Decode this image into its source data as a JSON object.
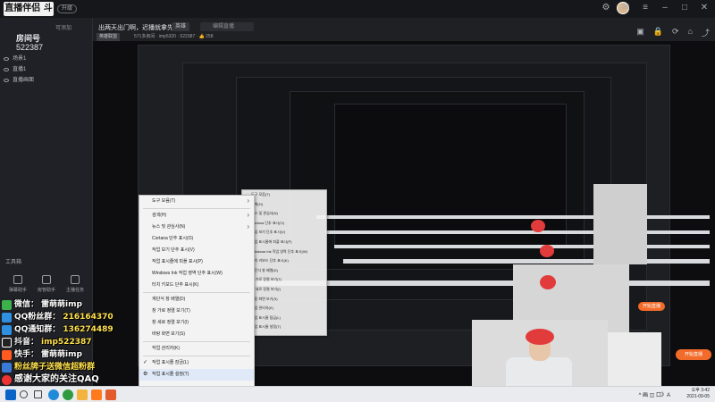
{
  "titlebar": {
    "logo_text": "直播伴侣 斗鱼",
    "version_badge": "升级",
    "window_controls": [
      "minimize",
      "maximize",
      "close"
    ]
  },
  "left_panel": {
    "room_label": "房间号",
    "room_number": "522387",
    "scene_label": "可添加",
    "scenes": [
      {
        "label": "场景1",
        "icon": "eye-icon"
      },
      {
        "label": "直播1",
        "icon": "eye-icon"
      },
      {
        "label": "直播画面",
        "icon": "eye-icon"
      }
    ],
    "tools_label": "工具箱",
    "tools": [
      {
        "label": "弹幕助手",
        "icon": "chat-icon"
      },
      {
        "label": "房管助手",
        "icon": "manage-icon"
      },
      {
        "label": "主播任务",
        "icon": "task-icon"
      }
    ]
  },
  "overlay": {
    "lines": [
      {
        "prefix": "微信：",
        "value": "雷萌萌imp",
        "icon_color": "#3bb34a"
      },
      {
        "prefix": "QQ粉丝群：",
        "value": "216164370",
        "icon_color": "#2f8fe0"
      },
      {
        "prefix": "QQ通知群：",
        "value": "136274489",
        "icon_color": "#2f8fe0"
      },
      {
        "prefix": "抖音：",
        "value": "imp522387",
        "icon_color": "#222"
      },
      {
        "prefix": "快手：",
        "value": "雷萌萌imp",
        "icon_color": "#ff5a1f"
      },
      {
        "prefix": "",
        "value": "粉丝牌子送微信超粉群",
        "icon_color": "#3a7bd5"
      },
      {
        "prefix": "",
        "value": "感谢大家的关注QAQ",
        "icon_color": "#e33"
      }
    ]
  },
  "topbar": {
    "title": "出两天出门啊，迟播就拿先播",
    "category": "英雄",
    "edit_placeholder": "编辑直播",
    "sub_badge": "英雄联盟",
    "stats": "571多房间 · imp5320 · 522387 · 👍 258",
    "icons": [
      "screen-icon",
      "lock-icon",
      "sync-icon",
      "home-icon",
      "share-icon"
    ]
  },
  "context_menu_left": {
    "items": [
      {
        "label": "도구 모음(T)",
        "arrow": true
      },
      {
        "sep": true
      },
      {
        "label": "검색(H)",
        "arrow": true
      },
      {
        "label": "뉴스 및 관심사(N)",
        "arrow": true
      },
      {
        "label": "Cortana 단추 표시(O)"
      },
      {
        "label": "작업 보기 단추 표시(V)"
      },
      {
        "label": "작업 표시줄에 피플 표시(P)"
      },
      {
        "label": "Windows Ink 작업 영역 단추 표시(W)"
      },
      {
        "label": "터치 키보드 단추 표시(K)"
      },
      {
        "sep": true
      },
      {
        "label": "계단식 창 배열(D)"
      },
      {
        "label": "창 가로 정렬 보기(T)"
      },
      {
        "label": "창 세로 정렬 보기(I)"
      },
      {
        "label": "바탕 화면 보기(S)"
      },
      {
        "sep": true
      },
      {
        "label": "작업 관리자(K)"
      },
      {
        "sep": true
      },
      {
        "label": "작업 표시줄 잠금(L)",
        "check": "✓"
      },
      {
        "label": "작업 표시줄 설정(T)",
        "check": "⚙",
        "highlight": true
      }
    ]
  },
  "context_menu_right": {
    "items": [
      {
        "label": "도구 모음(T)"
      },
      {
        "label": "검색(H)"
      },
      {
        "label": "뉴스 및 관심사(N)"
      },
      {
        "label": "Cortana 단추 표시(O)"
      },
      {
        "label": "작업 보기 단추 표시(V)"
      },
      {
        "label": "작업 표시줄에 피플 표시(P)"
      },
      {
        "label": "Windows Ink 작업 영역 단추 표시(W)"
      },
      {
        "label": "터치 키보드 단추 표시(K)"
      },
      {
        "label": "계단식 창 배열(D)"
      },
      {
        "label": "창 가로 정렬 보기(T)"
      },
      {
        "label": "창 세로 정렬 보기(I)"
      },
      {
        "label": "바탕 화면 보기(S)"
      },
      {
        "label": "작업 관리자(K)"
      },
      {
        "label": "작업 표시줄 잠금(L)"
      },
      {
        "label": "작업 표시줄 설정(T)"
      }
    ]
  },
  "preview": {
    "start_button": "开始直播",
    "cam_time": "2021-09-05"
  },
  "taskbar": {
    "tray": "^ 画 ◫ 口》A",
    "time": "오후 3:42",
    "date": "2021-09-05",
    "apps": [
      {
        "name": "start-icon",
        "color": "#0a64c8"
      },
      {
        "name": "search-icon",
        "color": "#444"
      },
      {
        "name": "taskview-icon",
        "color": "#444"
      },
      {
        "name": "edge-icon",
        "color": "#1f8ad9"
      },
      {
        "name": "chrome-icon",
        "color": "#2f9a3f"
      },
      {
        "name": "explorer-icon",
        "color": "#f3b33d"
      },
      {
        "name": "douyu-icon",
        "color": "#ff7a1a"
      },
      {
        "name": "app-icon",
        "color": "#e35a2c"
      }
    ]
  },
  "colors": {
    "accent": "#f26b2a",
    "background": "#1f2024",
    "hair": "#e23b3b"
  }
}
